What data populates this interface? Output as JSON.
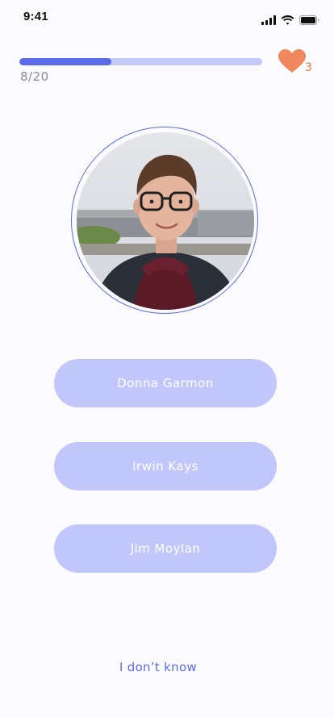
{
  "status_bar": {
    "time": "9:41"
  },
  "quiz": {
    "progress_text": "8/20",
    "progress_fraction": 0.38,
    "lives_count": "3",
    "accent_color": "#5b6ae8",
    "button_color": "#c2c7fb",
    "heart_color": "#f0875e"
  },
  "answers": [
    {
      "label": "Donna Garmon"
    },
    {
      "label": "Irwin Kays"
    },
    {
      "label": "Jim Moylan"
    }
  ],
  "skip_label": "I don’t know"
}
